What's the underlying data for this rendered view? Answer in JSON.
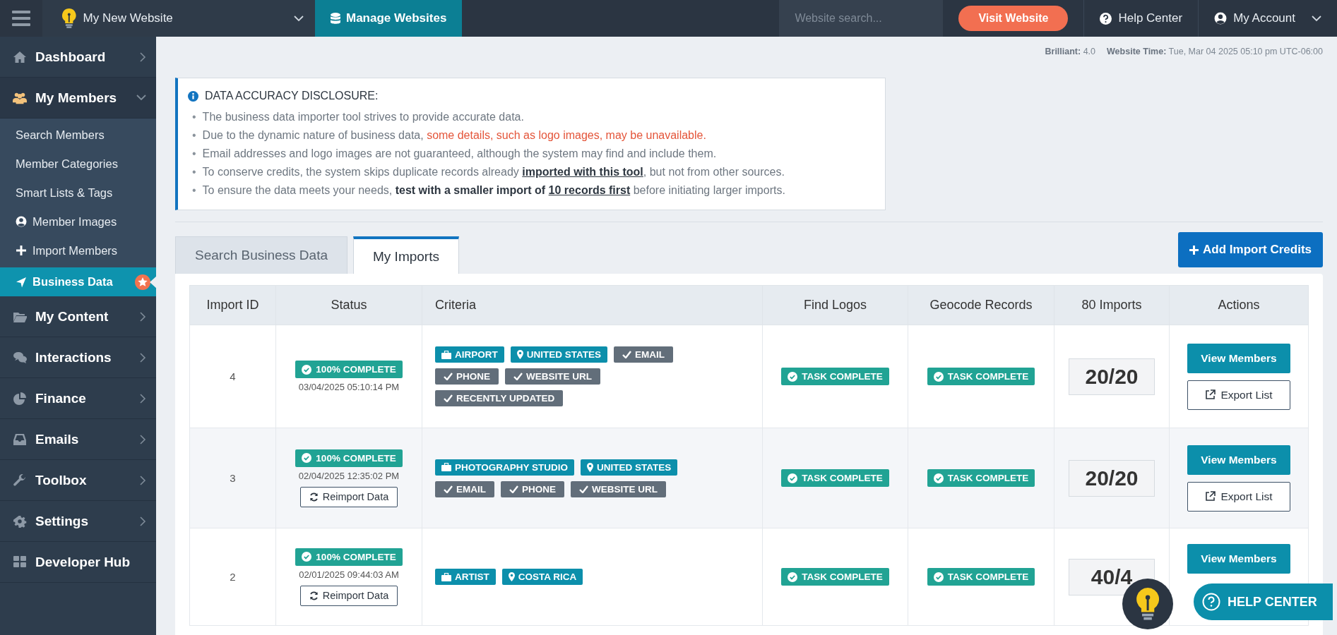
{
  "topbar": {
    "site_name": "My New Website",
    "manage": {
      "label": "Manage Websites",
      "selected": true
    },
    "search": {
      "placeholder": "Website search..."
    },
    "visit_button": "Visit Website",
    "help": "Help Center",
    "account": "My Account"
  },
  "sidebar": {
    "items": [
      {
        "kind": "group",
        "label": "Dashboard",
        "expanded": false
      },
      {
        "kind": "group",
        "label": "My Members",
        "expanded": true,
        "children": [
          {
            "label": "Search Members",
            "selected": false
          },
          {
            "label": "Member Categories",
            "selected": false
          },
          {
            "label": "Smart Lists & Tags",
            "selected": false
          },
          {
            "label": "Member Images",
            "selected": false
          },
          {
            "label": "Import Members",
            "selected": false
          },
          {
            "label": "Business Data",
            "selected": true,
            "starred": true
          }
        ]
      },
      {
        "kind": "group",
        "label": "My Content",
        "expanded": false
      },
      {
        "kind": "group",
        "label": "Interactions",
        "expanded": false
      },
      {
        "kind": "group",
        "label": "Finance",
        "expanded": false
      },
      {
        "kind": "group",
        "label": "Emails",
        "expanded": false
      },
      {
        "kind": "group",
        "label": "Toolbox",
        "expanded": false
      },
      {
        "kind": "group",
        "label": "Settings",
        "expanded": false
      },
      {
        "kind": "link",
        "label": "Developer Hub"
      }
    ]
  },
  "info_line": [
    "**Brilliant:** 4.0",
    "**Website Time:** Tue, Mar 04 2025 05:10 pm UTC-06:00"
  ],
  "disclosure": {
    "title": "DATA ACCURACY DISCLOSURE:",
    "bullets": [
      {
        "marker": "•",
        "segments": [
          {
            "kind": "plain",
            "text": "The business data importer tool strives to provide accurate data."
          }
        ]
      },
      {
        "marker": "•",
        "segments": [
          {
            "kind": "plain",
            "text": "Due to the dynamic nature of business data, "
          },
          {
            "kind": "alert",
            "text": "some details, such as logo images, may be unavailable."
          }
        ]
      },
      {
        "marker": "•",
        "segments": [
          {
            "kind": "plain",
            "text": "Email addresses and logo images are not guaranteed, although the system may find and include them."
          }
        ]
      },
      {
        "marker": "•",
        "segments": [
          {
            "kind": "plain",
            "text": "To conserve credits, the system skips duplicate records already "
          },
          {
            "kind": "link",
            "text": "imported with this tool"
          },
          {
            "kind": "plain",
            "text": ", but not from other sources."
          }
        ]
      },
      {
        "marker": "•",
        "segments": [
          {
            "kind": "plain",
            "text": "To ensure the data meets your needs, "
          },
          {
            "kind": "strong",
            "text": "test with a smaller import of "
          },
          {
            "kind": "link",
            "text": "10 records first"
          },
          {
            "kind": "plain",
            "text": " before initiating larger imports."
          }
        ]
      }
    ]
  },
  "tabs": [
    {
      "label": "Search Business Data",
      "selected": false
    },
    {
      "label": "My Imports",
      "selected": true
    }
  ],
  "add_credits_button": "Add Import Credits",
  "table": {
    "columns": [
      "Import ID",
      "Status",
      "Criteria",
      "Find Logos",
      "Geocode Records",
      "80 Imports",
      "Actions"
    ],
    "rows": [
      {
        "id": "4",
        "status": "100% COMPLETE",
        "date": "03/04/2025 05:10:14 PM",
        "tags": [
          {
            "kind": "category",
            "text": "AIRPORT"
          },
          {
            "kind": "location",
            "text": "UNITED STATES"
          },
          {
            "kind": "filter",
            "text": "EMAIL"
          },
          {
            "kind": "filter",
            "text": "PHONE"
          },
          {
            "kind": "filter",
            "text": "WEBSITE URL"
          },
          {
            "kind": "filter",
            "text": "RECENTLY UPDATED"
          }
        ],
        "logos": "TASK COMPLETE",
        "geocode": "TASK COMPLETE",
        "count": "20/20",
        "actions": [
          "View Members",
          "Export List"
        ]
      },
      {
        "id": "3",
        "status": "100% COMPLETE",
        "date": "02/04/2025 12:35:02 PM",
        "reimport": "Reimport Data",
        "tags": [
          {
            "kind": "category",
            "text": "PHOTOGRAPHY STUDIO"
          },
          {
            "kind": "location",
            "text": "UNITED STATES"
          },
          {
            "kind": "filter",
            "text": "EMAIL"
          },
          {
            "kind": "filter",
            "text": "PHONE"
          },
          {
            "kind": "filter",
            "text": "WEBSITE URL"
          }
        ],
        "logos": "TASK COMPLETE",
        "geocode": "TASK COMPLETE",
        "count": "20/20",
        "actions": [
          "View Members",
          "Export List"
        ]
      },
      {
        "id": "2",
        "status": "100% COMPLETE",
        "date": "02/01/2025 09:44:03 AM",
        "reimport": "Reimport Data",
        "tags": [
          {
            "kind": "category",
            "text": "ARTIST"
          },
          {
            "kind": "location",
            "text": "COSTA RICA"
          }
        ],
        "logos": "TASK COMPLETE",
        "geocode": "TASK COMPLETE",
        "count": "40/4",
        "actions": [
          "View Members"
        ]
      }
    ]
  },
  "help_center_button": "HELP CENTER"
}
